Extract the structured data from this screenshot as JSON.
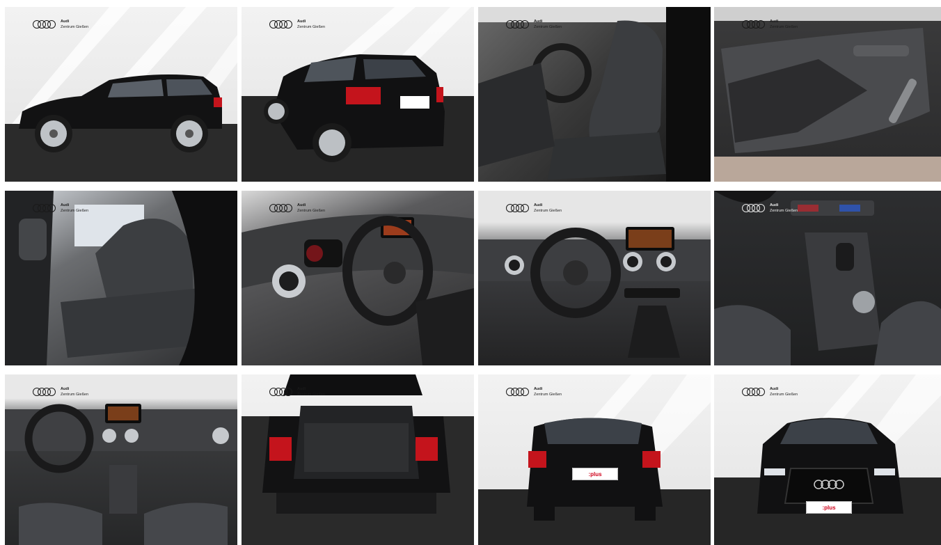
{
  "logo": {
    "brand": "Audi",
    "dealer": "Zentrum Gießen"
  },
  "plate_text": ":plus",
  "tiles": [
    {
      "icon": "car-side-view-photo"
    },
    {
      "icon": "car-rear-three-quarter-photo"
    },
    {
      "icon": "front-seats-photo"
    },
    {
      "icon": "door-panel-photo"
    },
    {
      "icon": "rear-seats-photo"
    },
    {
      "icon": "steering-wheel-photo"
    },
    {
      "icon": "dashboard-photo"
    },
    {
      "icon": "center-console-photo"
    },
    {
      "icon": "cockpit-overview-photo"
    },
    {
      "icon": "trunk-photo"
    },
    {
      "icon": "car-rear-photo"
    },
    {
      "icon": "car-front-photo"
    }
  ],
  "colors": {
    "studio_bg": "#efefef",
    "car_black": "#0f0f10",
    "taillight_red": "#c4141c",
    "leather": "#3a3b3d"
  }
}
